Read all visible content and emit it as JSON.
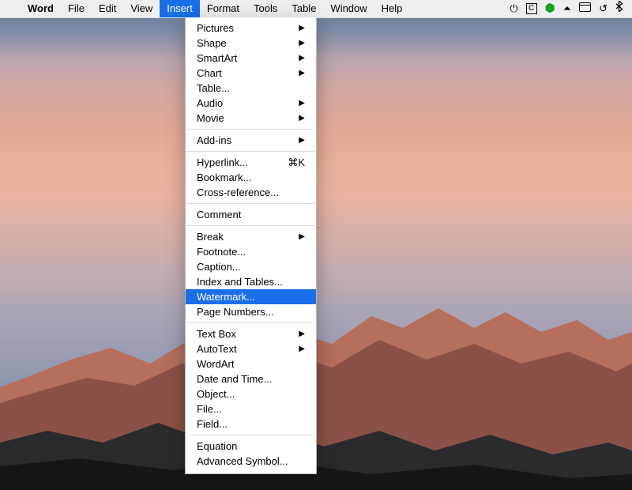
{
  "menubar": {
    "apple_icon": "",
    "app_name": "Word",
    "items": [
      "File",
      "Edit",
      "View",
      "Insert",
      "Format",
      "Tools",
      "Table",
      "Window",
      "Help"
    ],
    "active_index": 3,
    "status_icons": [
      "power-icon",
      "c-box-icon",
      "pentagon-icon",
      "airplay-icon",
      "date-icon",
      "timemachine-icon",
      "bluetooth-icon"
    ]
  },
  "dropdown": {
    "groups": [
      [
        {
          "label": "Pictures",
          "submenu": true
        },
        {
          "label": "Shape",
          "submenu": true
        },
        {
          "label": "SmartArt",
          "submenu": true
        },
        {
          "label": "Chart",
          "submenu": true
        },
        {
          "label": "Table...",
          "submenu": false
        },
        {
          "label": "Audio",
          "submenu": true
        },
        {
          "label": "Movie",
          "submenu": true
        }
      ],
      [
        {
          "label": "Add-ins",
          "submenu": true
        }
      ],
      [
        {
          "label": "Hyperlink...",
          "shortcut": "⌘K"
        },
        {
          "label": "Bookmark..."
        },
        {
          "label": "Cross-reference..."
        }
      ],
      [
        {
          "label": "Comment"
        }
      ],
      [
        {
          "label": "Break",
          "submenu": true
        },
        {
          "label": "Footnote..."
        },
        {
          "label": "Caption..."
        },
        {
          "label": "Index and Tables..."
        },
        {
          "label": "Watermark...",
          "highlight": true
        },
        {
          "label": "Page Numbers..."
        }
      ],
      [
        {
          "label": "Text Box",
          "submenu": true
        },
        {
          "label": "AutoText",
          "submenu": true
        },
        {
          "label": "WordArt"
        },
        {
          "label": "Date and Time..."
        },
        {
          "label": "Object..."
        },
        {
          "label": "File..."
        },
        {
          "label": "Field..."
        }
      ],
      [
        {
          "label": "Equation"
        },
        {
          "label": "Advanced Symbol..."
        }
      ]
    ]
  }
}
